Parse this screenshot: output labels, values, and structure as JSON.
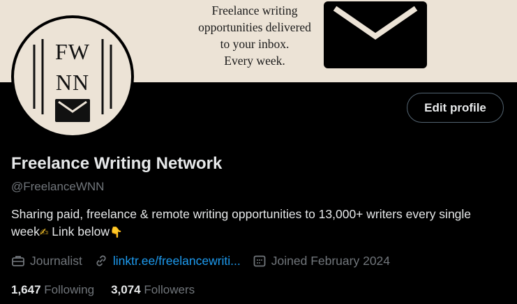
{
  "banner": {
    "lines": [
      "Freelance writing",
      "opportunities delivered",
      "to your inbox.",
      "Every week."
    ],
    "envelope_icon": "envelope-icon"
  },
  "avatar": {
    "logo_top": "FW",
    "logo_bottom": "NN",
    "icon": "envelope-icon"
  },
  "profile": {
    "edit_label": "Edit profile",
    "display_name": "Freelance Writing Network",
    "handle": "@FreelanceWNN",
    "bio_line": "Sharing paid, freelance & remote writing opportunities to 13,000+ writers every single week",
    "bio_emoji_1": "✍",
    "bio_link_text": " Link below",
    "bio_emoji_2": "👇"
  },
  "meta": {
    "profession": "Journalist",
    "profession_icon": "briefcase-icon",
    "link": "linktr.ee/freelancewriti...",
    "link_icon": "link-icon",
    "joined": "Joined February 2024",
    "joined_icon": "calendar-icon"
  },
  "stats": {
    "following_count": "1,647",
    "following_label": "Following",
    "followers_count": "3,074",
    "followers_label": "Followers"
  },
  "colors": {
    "background": "#000000",
    "banner": "#ece3d6",
    "text": "#e7e9ea",
    "muted": "#71767b",
    "link": "#1d9bf0"
  }
}
